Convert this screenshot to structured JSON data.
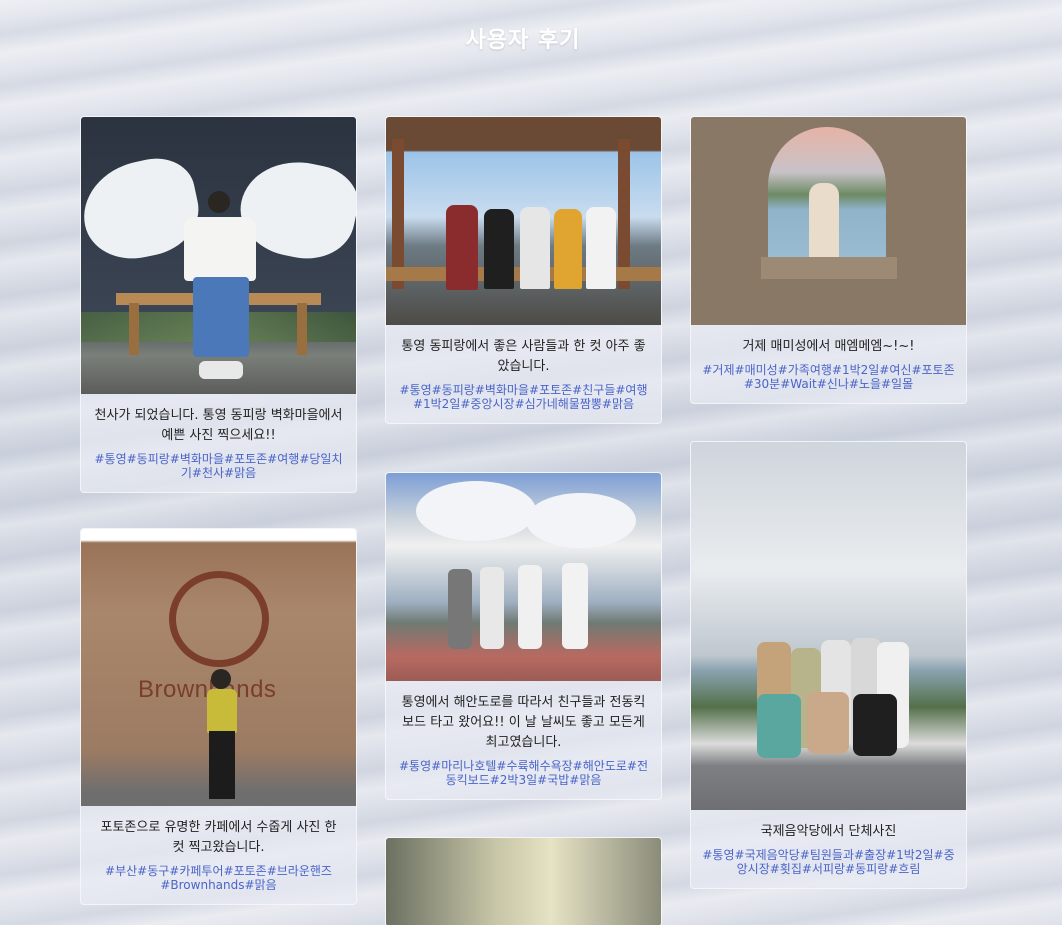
{
  "page": {
    "title": "사용자 후기"
  },
  "reviews": [
    {
      "caption": "천사가 되었습니다. 통영 동피랑 벽화마을에서 예쁜 사진 찍으세요!!",
      "tags": "#통영#동피랑#벽화마을#포토존#여행#당일치기#천사#맑음"
    },
    {
      "caption": "통영 동피랑에서 좋은 사람들과 한 컷 아주 좋았습니다.",
      "tags": "#통영#동피랑#벽화마을#포토존#친구들#여행#1박2일#중앙시장#심가네해물짬뽕#맑음"
    },
    {
      "caption": "거제 매미성에서 매엠메엠~!~!",
      "tags": "#거제#매미성#가족여행#1박2일#여신#포토존#30분#Wait#신나#노을#일몰"
    },
    {
      "caption": "포토존으로 유명한 카페에서 수줍게 사진 한 컷 찍고왔습니다.",
      "tags": "#부산#동구#카페투어#포토존#브라운핸즈#Brownhands#맑음",
      "sign_text": "Brownhands"
    },
    {
      "caption": "통영에서 해안도로를 따라서 친구들과 전동킥보드 타고 왔어요!! 이 날 날씨도 좋고 모든게 최고였습니다.",
      "tags": "#통영#마리나호텔#수륙해수욕장#해안도로#전동킥보드#2박3일#국밥#맑음"
    },
    {
      "caption": "국제음악당에서 단체사진",
      "tags": "#통영#국제음악당#팀원들과#출장#1박2일#중앙시장#횟집#서피랑#동피랑#흐림"
    }
  ],
  "colors": {
    "tag": "#4a64c9",
    "title": "#ffffff",
    "caption": "#222222"
  }
}
